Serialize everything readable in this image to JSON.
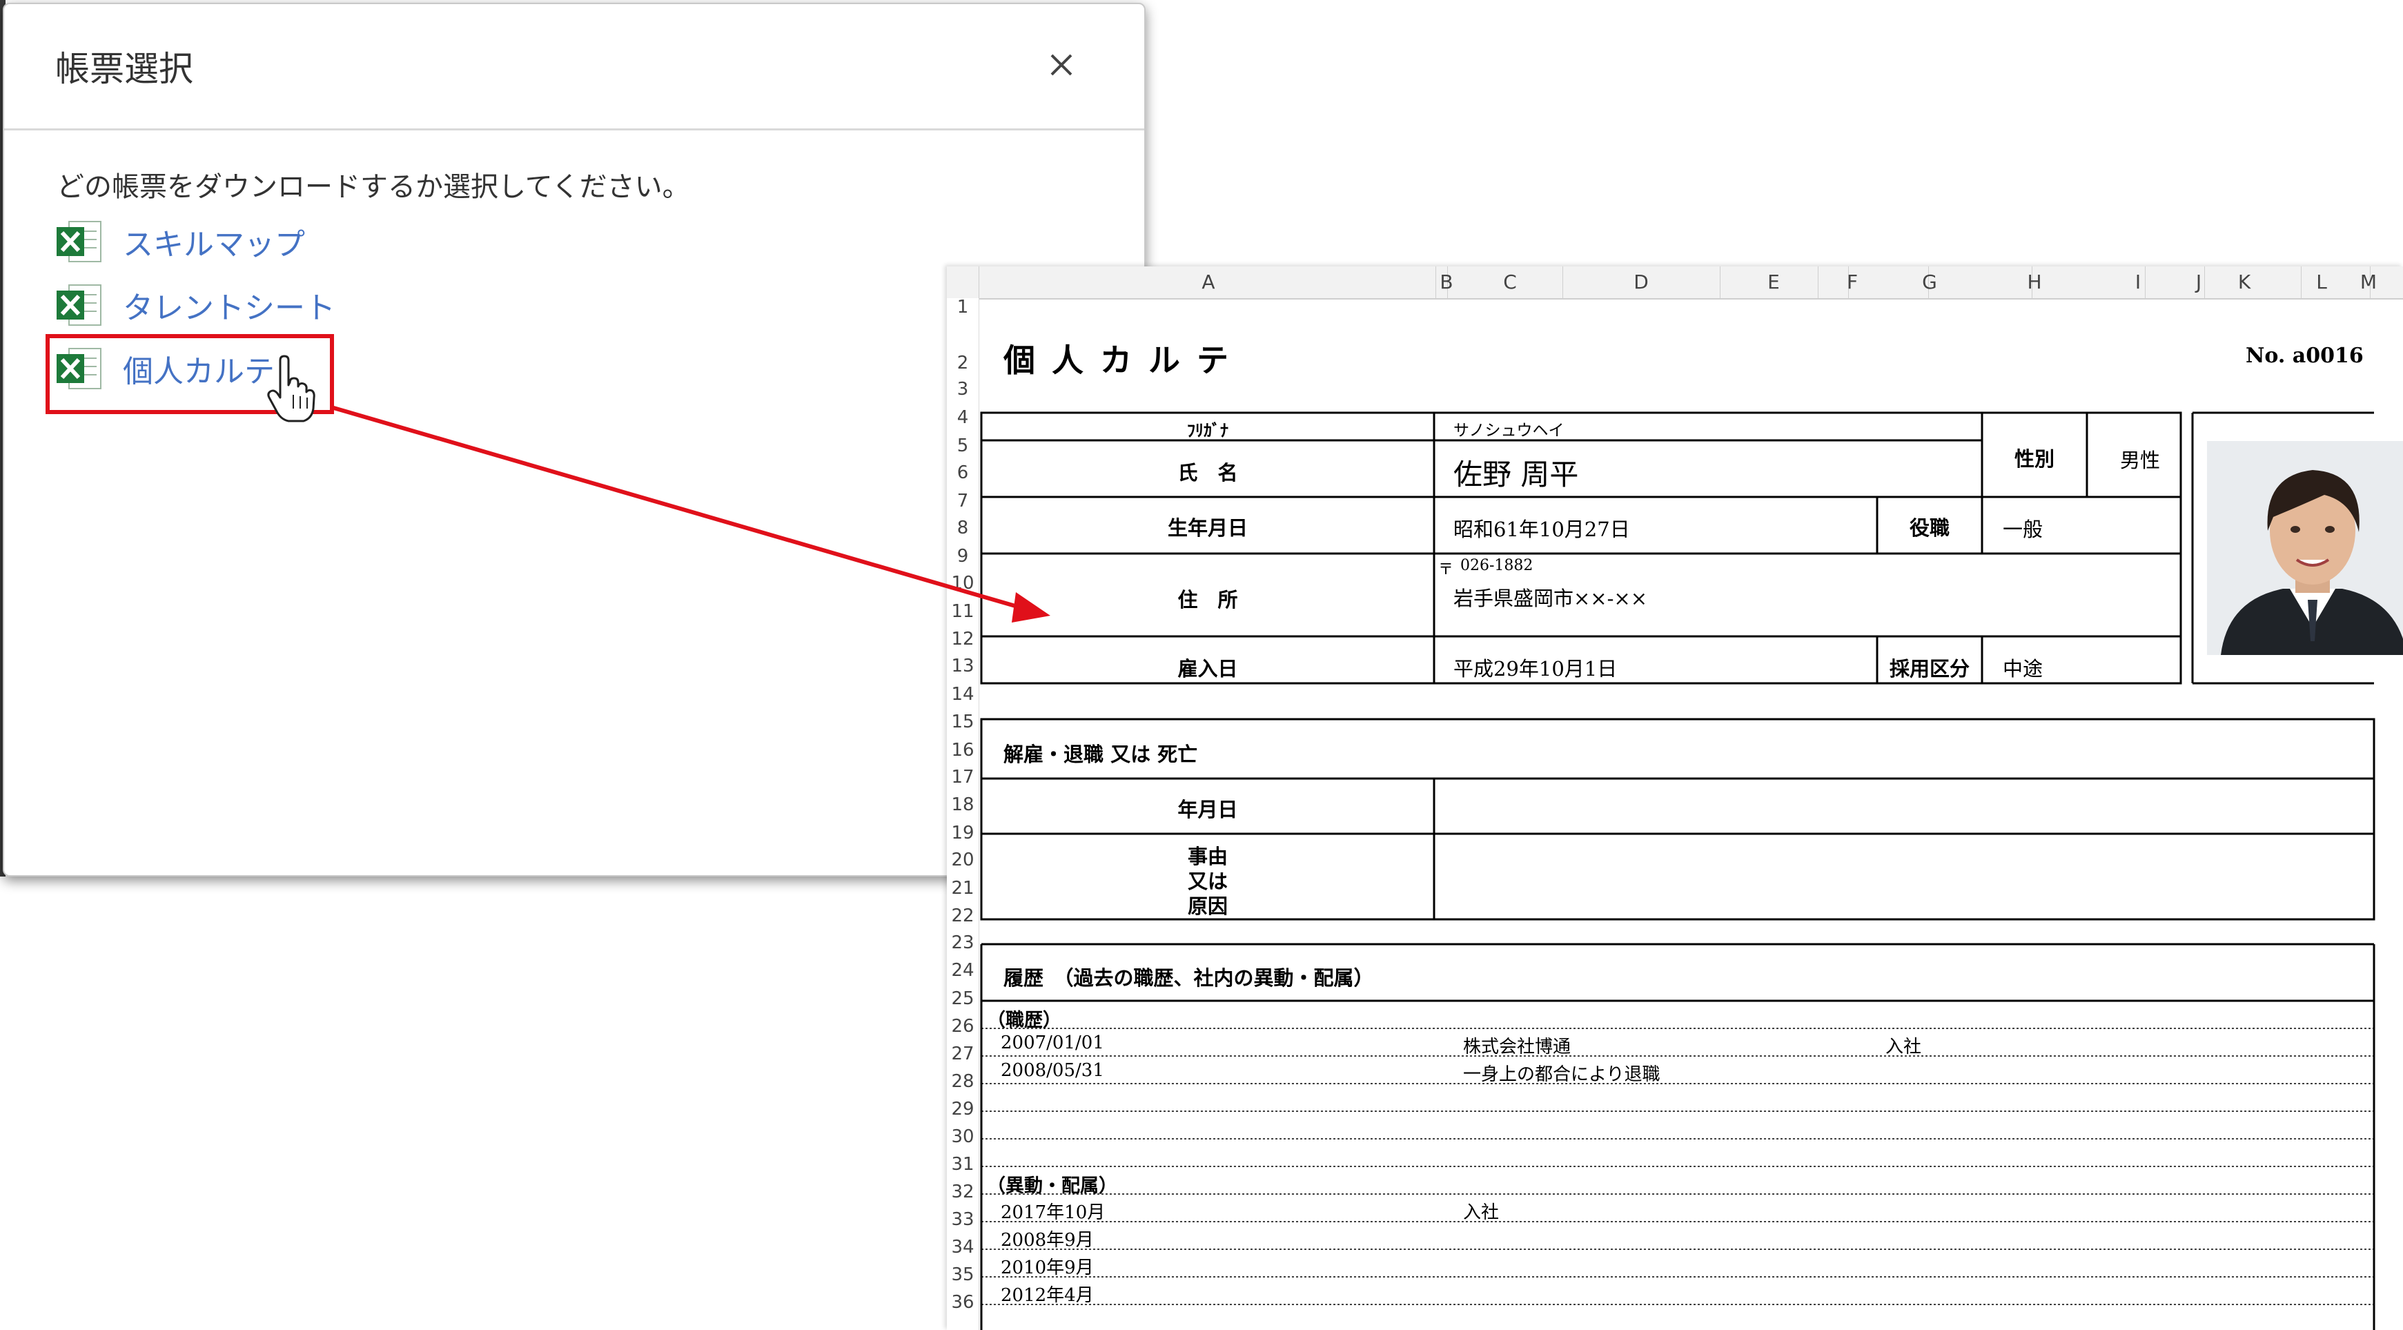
{
  "dialog": {
    "title": "帳票選択",
    "message": "どの帳票をダウンロードするか選択してください。",
    "items": [
      {
        "label": "スキルマップ"
      },
      {
        "label": "タレントシート"
      },
      {
        "label": "個人カルテ"
      }
    ]
  },
  "sheet": {
    "columns": [
      "A",
      "B",
      "C",
      "D",
      "E",
      "F",
      "G",
      "H",
      "I",
      "J",
      "K",
      "L",
      "M"
    ],
    "rows": [
      "1",
      "2",
      "3",
      "4",
      "5",
      "6",
      "7",
      "8",
      "9",
      "10",
      "11",
      "12",
      "13",
      "14",
      "15",
      "16",
      "17",
      "18",
      "19",
      "20",
      "21",
      "22",
      "23",
      "24",
      "25",
      "26",
      "27",
      "28",
      "29",
      "30",
      "31",
      "32",
      "33",
      "34",
      "35",
      "36"
    ],
    "title": "個 人 カ ル テ",
    "number": "No. a0016",
    "labels": {
      "furigana": "ﾌﾘｶﾞﾅ",
      "name": "氏　名",
      "gender": "性別",
      "birthdate": "生年月日",
      "position": "役職",
      "address": "住　所",
      "hire_date": "雇入日",
      "hire_type": "採用区分"
    },
    "values": {
      "furigana": "サノシュウヘイ",
      "name": "佐野 周平",
      "gender": "男性",
      "birthdate": "昭和61年10月27日",
      "position": "一般",
      "postal_mark": "〒",
      "postal_code": "026-1882",
      "address": "岩手県盛岡市××-××",
      "hire_date": "平成29年10月1日",
      "hire_type": "中途"
    },
    "dismissal": {
      "heading": "解雇・退職 又は 死亡",
      "date_label": "年月日",
      "reason_label_1": "事由",
      "reason_label_2": "又は",
      "reason_label_3": "原因"
    },
    "history": {
      "heading": "履歴　（過去の職歴、社内の異動・配属）",
      "career_label": "（職歴）",
      "career": [
        {
          "date": "2007/01/01",
          "detail": "株式会社博通",
          "note": "入社"
        },
        {
          "date": "2008/05/31",
          "detail": "一身上の都合により退職",
          "note": ""
        }
      ],
      "transfer_label": "（異動・配属）",
      "transfers": [
        {
          "date": "2017年10月",
          "detail": "入社"
        },
        {
          "date": "2008年9月",
          "detail": ""
        },
        {
          "date": "2010年9月",
          "detail": ""
        },
        {
          "date": "2012年4月",
          "detail": ""
        }
      ]
    }
  },
  "colors": {
    "link": "#4472c4",
    "highlight": "#e0101a",
    "arrow": "#e0101a",
    "excel_green": "#1d7a3a"
  }
}
